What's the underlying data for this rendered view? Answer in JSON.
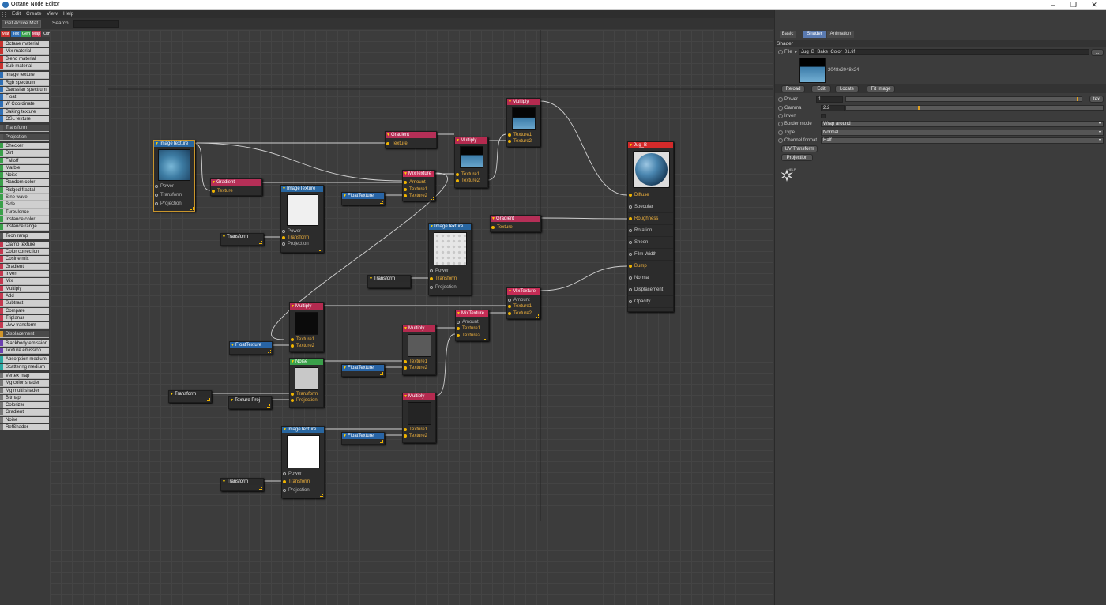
{
  "window": {
    "title": "Octane Node Editor"
  },
  "menu": [
    "Edit",
    "Create",
    "View",
    "Help"
  ],
  "toolbar": {
    "active_mat_button": "Get Active Mat",
    "search_label": "Search",
    "search_value": ""
  },
  "category_tabs": [
    {
      "label": "Mat",
      "color": "#c8322e"
    },
    {
      "label": "Tex",
      "color": "#2f6fb5"
    },
    {
      "label": "Gen",
      "color": "#3aa04a"
    },
    {
      "label": "Map",
      "color": "#c4384f"
    },
    {
      "label": "Oth",
      "color": "#444444"
    },
    {
      "label": "Ems",
      "color": "#6b3fb0"
    },
    {
      "label": "Med",
      "color": "#2aa6a0"
    },
    {
      "label": "C4D",
      "color": "#777777"
    }
  ],
  "library": [
    {
      "label": "Octane material",
      "color": "#c8322e"
    },
    {
      "label": "Mix material",
      "color": "#c8322e"
    },
    {
      "label": "Blend material",
      "color": "#c8322e"
    },
    {
      "label": "Sub material",
      "color": "#c8322e"
    },
    {
      "label": "Image texture",
      "color": "#2f6fb5"
    },
    {
      "label": "Rgb spectrum",
      "color": "#2f6fb5"
    },
    {
      "label": "Gaussian spectrum",
      "color": "#2f6fb5"
    },
    {
      "label": "Float",
      "color": "#2f6fb5"
    },
    {
      "label": "W Coordinate",
      "color": "#2f6fb5"
    },
    {
      "label": "Baking texture",
      "color": "#2f6fb5"
    },
    {
      "label": "OSL texture",
      "color": "#2f6fb5"
    },
    {
      "label": "Transform",
      "color": "#555555",
      "dark": true
    },
    {
      "label": "Projection",
      "color": "#555555",
      "dark": true
    },
    {
      "label": "Checker",
      "color": "#3aa04a"
    },
    {
      "label": "Dirt",
      "color": "#3aa04a"
    },
    {
      "label": "Falloff",
      "color": "#3aa04a"
    },
    {
      "label": "Marble",
      "color": "#3aa04a"
    },
    {
      "label": "Noise",
      "color": "#3aa04a"
    },
    {
      "label": "Random color",
      "color": "#3aa04a"
    },
    {
      "label": "Ridged fractal",
      "color": "#3aa04a"
    },
    {
      "label": "Sine wave",
      "color": "#3aa04a"
    },
    {
      "label": "Side",
      "color": "#3aa04a"
    },
    {
      "label": "Turbulence",
      "color": "#3aa04a"
    },
    {
      "label": "Instance color",
      "color": "#3aa04a"
    },
    {
      "label": "Instance range",
      "color": "#3aa04a"
    },
    {
      "label": "Toon ramp",
      "color": "#555555"
    },
    {
      "label": "Clamp texture",
      "color": "#c4384f"
    },
    {
      "label": "Color correction",
      "color": "#c4384f"
    },
    {
      "label": "Cosine mix",
      "color": "#c4384f"
    },
    {
      "label": "Gradient",
      "color": "#c4384f"
    },
    {
      "label": "Invert",
      "color": "#c4384f"
    },
    {
      "label": "Mix",
      "color": "#c4384f"
    },
    {
      "label": "Multiply",
      "color": "#c4384f"
    },
    {
      "label": "Add",
      "color": "#c4384f"
    },
    {
      "label": "Subtract",
      "color": "#c4384f"
    },
    {
      "label": "Compare",
      "color": "#c4384f"
    },
    {
      "label": "Triplanar",
      "color": "#c4384f"
    },
    {
      "label": "Uvw transform",
      "color": "#c4384f"
    },
    {
      "label": "Displacement",
      "color": "#d0952a",
      "dark": true
    },
    {
      "label": "Blackbody emission",
      "color": "#6b3fb0"
    },
    {
      "label": "Texture emission",
      "color": "#6b3fb0"
    },
    {
      "label": "Absorption medium",
      "color": "#2aa6a0"
    },
    {
      "label": "Scattering medium",
      "color": "#2aa6a0"
    },
    {
      "label": "Vertex map",
      "color": "#777777"
    },
    {
      "label": "Mg color shader",
      "color": "#777777"
    },
    {
      "label": "Mg multi shader",
      "color": "#777777"
    },
    {
      "label": "Bitmap",
      "color": "#777777"
    },
    {
      "label": "Colorizer",
      "color": "#777777"
    },
    {
      "label": "Gradient",
      "color": "#777777"
    },
    {
      "label": "Noise",
      "color": "#777777"
    },
    {
      "label": "RefShader",
      "color": "#777777"
    }
  ],
  "nodes": {
    "img1": {
      "title": "ImageTexture",
      "ports": [
        "Power",
        "Transform",
        "Projection"
      ]
    },
    "grad1": {
      "title": "Gradient",
      "ports": [
        "Texture"
      ]
    },
    "grad2": {
      "title": "Gradient",
      "ports": [
        "Texture"
      ]
    },
    "mix1": {
      "title": "MixTexture",
      "ports": [
        "Amount",
        "Texture1",
        "Texture2"
      ]
    },
    "mult1": {
      "title": "Multiply",
      "ports": [
        "Texture1",
        "Texture2"
      ]
    },
    "mult2": {
      "title": "Multiply",
      "ports": [
        "Texture1",
        "Texture2"
      ]
    },
    "img2": {
      "title": "ImageTexture",
      "ports": [
        "Power",
        "Transform",
        "Projection"
      ]
    },
    "float1": {
      "title": "FloatTexture"
    },
    "tr1": {
      "title": "Transform"
    },
    "grad3": {
      "title": "Gradient",
      "ports": [
        "Texture"
      ]
    },
    "img3": {
      "title": "ImageTexture",
      "ports": [
        "Power",
        "Transform",
        "Projection"
      ]
    },
    "tr2": {
      "title": "Transform"
    },
    "mix2": {
      "title": "MixTexture",
      "ports": [
        "Amount",
        "Texture1",
        "Texture2"
      ]
    },
    "mix3": {
      "title": "MixTexture",
      "ports": [
        "Amount",
        "Texture1",
        "Texture2"
      ]
    },
    "mult3": {
      "title": "Multiply",
      "ports": [
        "Texture1",
        "Texture2"
      ]
    },
    "float2": {
      "title": "FloatTexture"
    },
    "mult4": {
      "title": "Multiply",
      "ports": [
        "Texture1",
        "Texture2"
      ]
    },
    "noise1": {
      "title": "Noise",
      "ports": [
        "Transform",
        "Projection"
      ]
    },
    "float3": {
      "title": "FloatTexture"
    },
    "tr3": {
      "title": "Transform"
    },
    "proj1": {
      "title": "Texture Proj"
    },
    "mult5": {
      "title": "Multiply",
      "ports": [
        "Texture1",
        "Texture2"
      ]
    },
    "img4": {
      "title": "ImageTexture",
      "ports": [
        "Power",
        "Transform",
        "Projection"
      ]
    },
    "float4": {
      "title": "FloatTexture"
    },
    "tr4": {
      "title": "Transform"
    },
    "out": {
      "title": "Jug_B",
      "ports": [
        "Diffuse",
        "Specular",
        "Roughness",
        "Rotation",
        "Sheen",
        "Film Width",
        "Bump",
        "Normal",
        "Displacement",
        "Opacity"
      ]
    }
  },
  "panel": {
    "tabs": [
      "Basic",
      "Shader",
      "Animation"
    ],
    "active_tab": "Shader",
    "section": "Shader",
    "file_label": "File",
    "file_value": "Jug_B_Bake_Color_01.tif",
    "file_browse": "...",
    "image_info": "2048x2048x24",
    "buttons": [
      "Reload",
      "Edit",
      "Locate",
      "Fit Image"
    ],
    "power_label": "Power",
    "power_value": "1.",
    "power_fraction": 0.98,
    "power_btn": "tex",
    "gamma_label": "Gamma",
    "gamma_value": "2.2",
    "gamma_fraction": 0.28,
    "invert_label": "Invert",
    "border_label": "Border mode",
    "border_value": "Wrap around",
    "type_label": "Type",
    "type_value": "Normal",
    "channel_label": "Channel format",
    "channel_value": "Half",
    "uv_button": "UV Transform",
    "projection_button": "Projection",
    "help_label": "HELP"
  }
}
